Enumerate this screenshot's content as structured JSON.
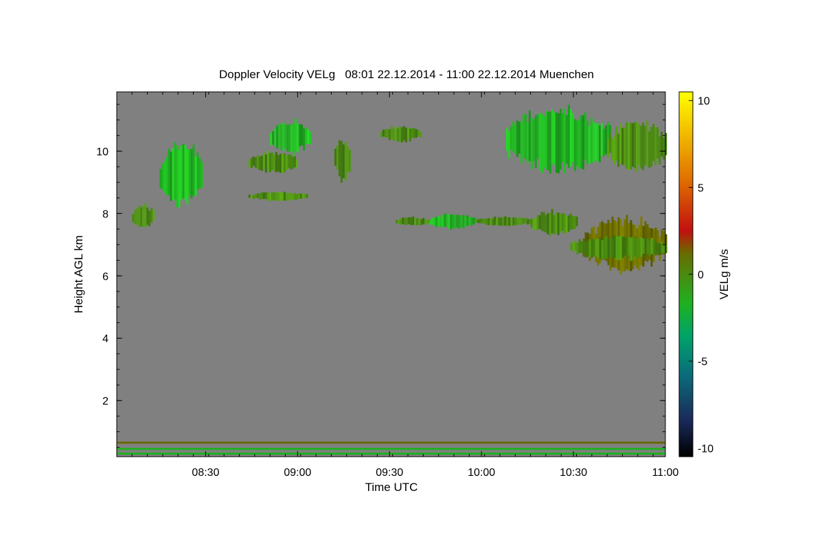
{
  "chart_data": {
    "type": "heatmap",
    "title": "Doppler Velocity VELg   08:01 22.12.2014 - 11:00 22.12.2014 Muenchen",
    "xlabel": "Time UTC",
    "ylabel": "Height AGL km",
    "x_range": [
      "08:01",
      "11:00"
    ],
    "xlim_minutes": [
      481,
      660
    ],
    "ylim": [
      0.2,
      11.9
    ],
    "x_ticks": [
      {
        "label": "08:30",
        "minutes": 510
      },
      {
        "label": "09:00",
        "minutes": 540
      },
      {
        "label": "09:30",
        "minutes": 570
      },
      {
        "label": "10:00",
        "minutes": 600
      },
      {
        "label": "10:30",
        "minutes": 630
      },
      {
        "label": "11:00",
        "minutes": 660
      }
    ],
    "y_ticks": [
      2,
      4,
      6,
      8,
      10
    ],
    "colorbar": {
      "label": "VELg m/s",
      "range": [
        -10.5,
        10.5
      ],
      "ticks": [
        -10,
        -5,
        0,
        5,
        10
      ],
      "colors": [
        "#000000",
        "#1a2a5a",
        "#0b6a7a",
        "#00a36a",
        "#1fb020",
        "#4a8a10",
        "#6a6a00",
        "#c21010",
        "#e07000",
        "#f0b800",
        "#ffff00"
      ]
    },
    "background_color": "#808080",
    "regions": [
      {
        "t0": 495,
        "t1": 509,
        "h0": 8.2,
        "h1": 10.3,
        "v": -1.5
      },
      {
        "t0": 486,
        "t1": 493,
        "h0": 7.5,
        "h1": 8.3,
        "v": -1.0
      },
      {
        "t0": 524,
        "t1": 540,
        "h0": 9.3,
        "h1": 10.0,
        "v": -0.5
      },
      {
        "t0": 531,
        "t1": 544,
        "h0": 9.9,
        "h1": 11.0,
        "v": -1.8
      },
      {
        "t0": 524,
        "t1": 543,
        "h0": 8.4,
        "h1": 8.7,
        "v": -0.6
      },
      {
        "t0": 552,
        "t1": 557,
        "h0": 9.0,
        "h1": 10.4,
        "v": -0.3
      },
      {
        "t0": 567,
        "t1": 580,
        "h0": 10.3,
        "h1": 10.8,
        "v": -0.8
      },
      {
        "t0": 572,
        "t1": 583,
        "h0": 7.6,
        "h1": 7.9,
        "v": 0.6
      },
      {
        "t0": 583,
        "t1": 598,
        "h0": 7.5,
        "h1": 8.0,
        "v": -1.2
      },
      {
        "t0": 598,
        "t1": 617,
        "h0": 7.6,
        "h1": 7.9,
        "v": 0.4
      },
      {
        "t0": 616,
        "t1": 631,
        "h0": 7.3,
        "h1": 8.1,
        "v": 0.9
      },
      {
        "t0": 633,
        "t1": 660,
        "h0": 6.1,
        "h1": 7.9,
        "v": 1.8
      },
      {
        "t0": 629,
        "t1": 660,
        "h0": 6.5,
        "h1": 7.3,
        "v": -1.0
      },
      {
        "t0": 608,
        "t1": 642,
        "h0": 9.3,
        "h1": 11.4,
        "v": -1.2
      },
      {
        "t0": 641,
        "t1": 660,
        "h0": 9.3,
        "h1": 11.0,
        "v": -0.8
      }
    ],
    "lines": [
      {
        "h": 0.65,
        "v": 2.5
      },
      {
        "h": 0.45,
        "v": -1.2
      },
      {
        "h": 0.3,
        "v": -2.2
      }
    ]
  }
}
